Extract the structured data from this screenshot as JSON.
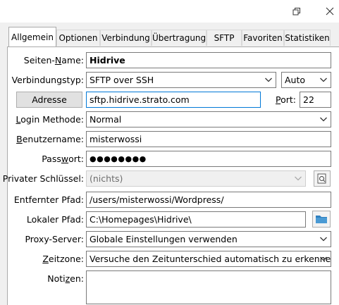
{
  "tabs": [
    "Allgemein",
    "Optionen",
    "Verbindung",
    "Übertragung",
    "SFTP",
    "Favoriten",
    "Statistiken"
  ],
  "window": {
    "restore_icon": "restore-icon",
    "close_icon": "close-icon"
  },
  "form": {
    "site_name": {
      "prefix": "Seiten-",
      "underlined": "N",
      "suffix": "ame:",
      "value": "Hidrive"
    },
    "conn_type": {
      "label": "Verbindungstyp:",
      "value": "SFTP over SSH",
      "mode": "Auto"
    },
    "address": {
      "button": "Adresse",
      "value": "sftp.hidrive.strato.com",
      "port_prefix": "",
      "port_underlined": "P",
      "port_suffix": "ort:",
      "port": "22"
    },
    "login": {
      "prefix": "",
      "underlined": "L",
      "suffix": "ogin Methode:",
      "value": "Normal"
    },
    "user": {
      "prefix": "",
      "underlined": "B",
      "suffix": "enutzername:",
      "value": "misterwossi"
    },
    "password": {
      "prefix": "Pass",
      "underlined": "w",
      "suffix": "ort:",
      "value": "●●●●●●●●"
    },
    "private_key": {
      "label": "Privater Schlüssel:",
      "value": "(nichts)"
    },
    "remote_path": {
      "label": "Entfernter Pfad:",
      "value": "/users/misterwossi/Wordpress/"
    },
    "local_path": {
      "label": "Lokaler Pfad:",
      "value": "C:\\Homepages\\Hidrive\\"
    },
    "proxy": {
      "label": "Proxy-Server:",
      "value": "Globale Einstellungen verwenden"
    },
    "timezone": {
      "prefix": "",
      "underlined": "Z",
      "suffix": "eitzone:",
      "value": "Versuche den Zeitunterschied automatisch zu erkennen"
    },
    "notes": {
      "prefix": "Noti",
      "underlined": "z",
      "suffix": "en:"
    }
  },
  "colors": {
    "accent": "#0078d7",
    "folder": "#2e7fbf"
  }
}
